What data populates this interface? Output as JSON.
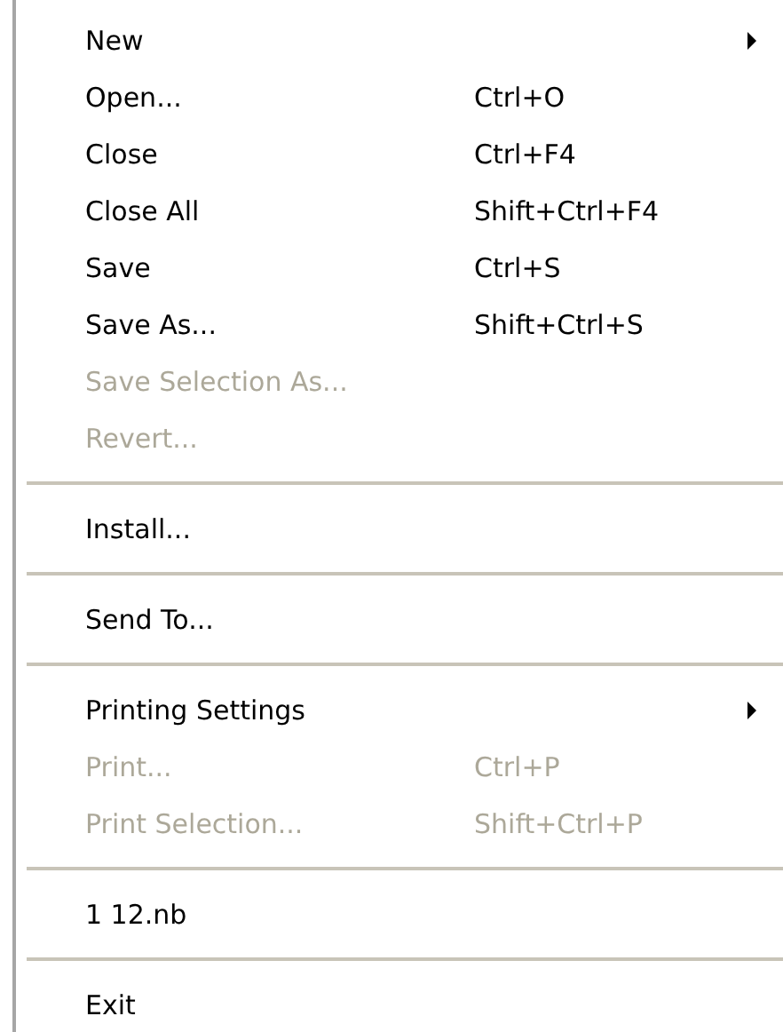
{
  "menu": {
    "groups": [
      {
        "items": [
          {
            "label": "New",
            "submenu": true,
            "disabled": false
          },
          {
            "label": "Open...",
            "shortcut": "Ctrl+O",
            "submenu": false,
            "disabled": false
          },
          {
            "label": "Close",
            "shortcut": "Ctrl+F4",
            "submenu": false,
            "disabled": false
          },
          {
            "label": "Close All",
            "shortcut": "Shift+Ctrl+F4",
            "submenu": false,
            "disabled": false
          },
          {
            "label": "Save",
            "shortcut": "Ctrl+S",
            "submenu": false,
            "disabled": false
          },
          {
            "label": "Save As...",
            "shortcut": "Shift+Ctrl+S",
            "submenu": false,
            "disabled": false
          },
          {
            "label": "Save Selection As...",
            "submenu": false,
            "disabled": true
          },
          {
            "label": "Revert...",
            "submenu": false,
            "disabled": true
          }
        ]
      },
      {
        "items": [
          {
            "label": "Install...",
            "submenu": false,
            "disabled": false
          }
        ]
      },
      {
        "items": [
          {
            "label": "Send To...",
            "submenu": false,
            "disabled": false
          }
        ]
      },
      {
        "items": [
          {
            "label": "Printing Settings",
            "submenu": true,
            "disabled": false
          },
          {
            "label": "Print...",
            "shortcut": "Ctrl+P",
            "submenu": false,
            "disabled": true
          },
          {
            "label": "Print Selection...",
            "shortcut": "Shift+Ctrl+P",
            "submenu": false,
            "disabled": true
          }
        ]
      },
      {
        "items": [
          {
            "label": "1 12.nb",
            "submenu": false,
            "disabled": false
          }
        ]
      },
      {
        "items": [
          {
            "label": "Exit",
            "submenu": false,
            "disabled": false
          }
        ]
      }
    ]
  }
}
